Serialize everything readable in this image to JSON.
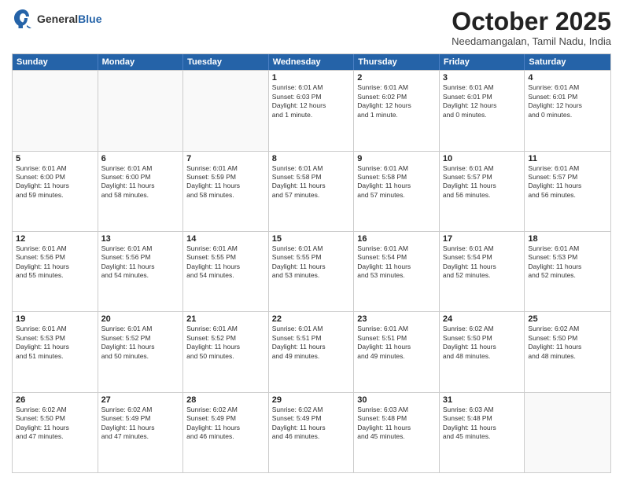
{
  "header": {
    "logo_general": "General",
    "logo_blue": "Blue",
    "month_title": "October 2025",
    "location": "Needamangalan, Tamil Nadu, India"
  },
  "weekdays": [
    "Sunday",
    "Monday",
    "Tuesday",
    "Wednesday",
    "Thursday",
    "Friday",
    "Saturday"
  ],
  "rows": [
    [
      {
        "date": "",
        "info": ""
      },
      {
        "date": "",
        "info": ""
      },
      {
        "date": "",
        "info": ""
      },
      {
        "date": "1",
        "info": "Sunrise: 6:01 AM\nSunset: 6:03 PM\nDaylight: 12 hours\nand 1 minute."
      },
      {
        "date": "2",
        "info": "Sunrise: 6:01 AM\nSunset: 6:02 PM\nDaylight: 12 hours\nand 1 minute."
      },
      {
        "date": "3",
        "info": "Sunrise: 6:01 AM\nSunset: 6:01 PM\nDaylight: 12 hours\nand 0 minutes."
      },
      {
        "date": "4",
        "info": "Sunrise: 6:01 AM\nSunset: 6:01 PM\nDaylight: 12 hours\nand 0 minutes."
      }
    ],
    [
      {
        "date": "5",
        "info": "Sunrise: 6:01 AM\nSunset: 6:00 PM\nDaylight: 11 hours\nand 59 minutes."
      },
      {
        "date": "6",
        "info": "Sunrise: 6:01 AM\nSunset: 6:00 PM\nDaylight: 11 hours\nand 58 minutes."
      },
      {
        "date": "7",
        "info": "Sunrise: 6:01 AM\nSunset: 5:59 PM\nDaylight: 11 hours\nand 58 minutes."
      },
      {
        "date": "8",
        "info": "Sunrise: 6:01 AM\nSunset: 5:58 PM\nDaylight: 11 hours\nand 57 minutes."
      },
      {
        "date": "9",
        "info": "Sunrise: 6:01 AM\nSunset: 5:58 PM\nDaylight: 11 hours\nand 57 minutes."
      },
      {
        "date": "10",
        "info": "Sunrise: 6:01 AM\nSunset: 5:57 PM\nDaylight: 11 hours\nand 56 minutes."
      },
      {
        "date": "11",
        "info": "Sunrise: 6:01 AM\nSunset: 5:57 PM\nDaylight: 11 hours\nand 56 minutes."
      }
    ],
    [
      {
        "date": "12",
        "info": "Sunrise: 6:01 AM\nSunset: 5:56 PM\nDaylight: 11 hours\nand 55 minutes."
      },
      {
        "date": "13",
        "info": "Sunrise: 6:01 AM\nSunset: 5:56 PM\nDaylight: 11 hours\nand 54 minutes."
      },
      {
        "date": "14",
        "info": "Sunrise: 6:01 AM\nSunset: 5:55 PM\nDaylight: 11 hours\nand 54 minutes."
      },
      {
        "date": "15",
        "info": "Sunrise: 6:01 AM\nSunset: 5:55 PM\nDaylight: 11 hours\nand 53 minutes."
      },
      {
        "date": "16",
        "info": "Sunrise: 6:01 AM\nSunset: 5:54 PM\nDaylight: 11 hours\nand 53 minutes."
      },
      {
        "date": "17",
        "info": "Sunrise: 6:01 AM\nSunset: 5:54 PM\nDaylight: 11 hours\nand 52 minutes."
      },
      {
        "date": "18",
        "info": "Sunrise: 6:01 AM\nSunset: 5:53 PM\nDaylight: 11 hours\nand 52 minutes."
      }
    ],
    [
      {
        "date": "19",
        "info": "Sunrise: 6:01 AM\nSunset: 5:53 PM\nDaylight: 11 hours\nand 51 minutes."
      },
      {
        "date": "20",
        "info": "Sunrise: 6:01 AM\nSunset: 5:52 PM\nDaylight: 11 hours\nand 50 minutes."
      },
      {
        "date": "21",
        "info": "Sunrise: 6:01 AM\nSunset: 5:52 PM\nDaylight: 11 hours\nand 50 minutes."
      },
      {
        "date": "22",
        "info": "Sunrise: 6:01 AM\nSunset: 5:51 PM\nDaylight: 11 hours\nand 49 minutes."
      },
      {
        "date": "23",
        "info": "Sunrise: 6:01 AM\nSunset: 5:51 PM\nDaylight: 11 hours\nand 49 minutes."
      },
      {
        "date": "24",
        "info": "Sunrise: 6:02 AM\nSunset: 5:50 PM\nDaylight: 11 hours\nand 48 minutes."
      },
      {
        "date": "25",
        "info": "Sunrise: 6:02 AM\nSunset: 5:50 PM\nDaylight: 11 hours\nand 48 minutes."
      }
    ],
    [
      {
        "date": "26",
        "info": "Sunrise: 6:02 AM\nSunset: 5:50 PM\nDaylight: 11 hours\nand 47 minutes."
      },
      {
        "date": "27",
        "info": "Sunrise: 6:02 AM\nSunset: 5:49 PM\nDaylight: 11 hours\nand 47 minutes."
      },
      {
        "date": "28",
        "info": "Sunrise: 6:02 AM\nSunset: 5:49 PM\nDaylight: 11 hours\nand 46 minutes."
      },
      {
        "date": "29",
        "info": "Sunrise: 6:02 AM\nSunset: 5:49 PM\nDaylight: 11 hours\nand 46 minutes."
      },
      {
        "date": "30",
        "info": "Sunrise: 6:03 AM\nSunset: 5:48 PM\nDaylight: 11 hours\nand 45 minutes."
      },
      {
        "date": "31",
        "info": "Sunrise: 6:03 AM\nSunset: 5:48 PM\nDaylight: 11 hours\nand 45 minutes."
      },
      {
        "date": "",
        "info": ""
      }
    ]
  ]
}
